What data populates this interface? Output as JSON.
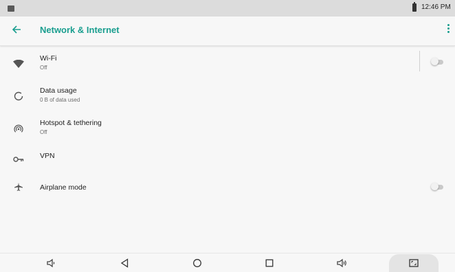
{
  "status_bar": {
    "time": "12:46 PM"
  },
  "app_bar": {
    "title": "Network & Internet",
    "back_icon": "arrow-back-icon",
    "menu_icon": "more-vert-icon"
  },
  "settings": [
    {
      "id": "wifi",
      "title": "Wi-Fi",
      "summary": "Off",
      "icon": "wifi-icon",
      "toggle": false
    },
    {
      "id": "data-usage",
      "title": "Data usage",
      "summary": "0 B of data used",
      "icon": "data-usage-icon"
    },
    {
      "id": "hotspot",
      "title": "Hotspot & tethering",
      "summary": "Off",
      "icon": "hotspot-icon"
    },
    {
      "id": "vpn",
      "title": "VPN",
      "summary": "",
      "icon": "vpn-key-icon"
    },
    {
      "id": "airplane",
      "title": "Airplane mode",
      "summary": "",
      "icon": "airplane-icon",
      "toggle": false
    }
  ],
  "nav_bar": {
    "items": [
      "volume-down-icon",
      "back-triangle-icon",
      "home-circle-icon",
      "recents-square-icon",
      "volume-up-icon",
      "screenshot-icon"
    ]
  },
  "colors": {
    "accent": "#1a9e8f",
    "status_bar_bg": "#dcdcdc",
    "page_bg": "#f7f7f7"
  }
}
